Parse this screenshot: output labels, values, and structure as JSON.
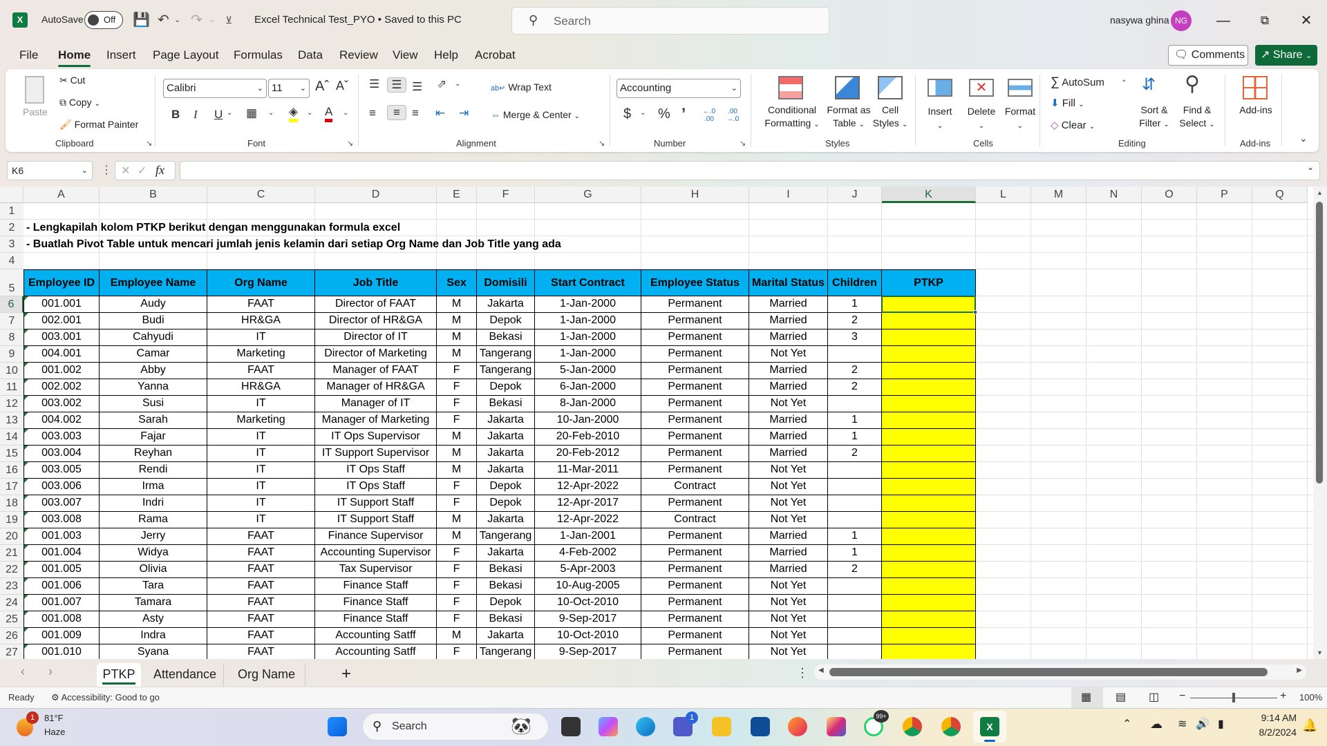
{
  "titlebar": {
    "autosave_label": "AutoSave",
    "autosave_state": "Off",
    "document_title": "Excel Technical Test_PYO • Saved to this PC",
    "search_placeholder": "Search",
    "user_name": "nasywa ghina",
    "user_initials": "NG",
    "avatar_color": "#c43ec0"
  },
  "menu": {
    "items": [
      "File",
      "Home",
      "Insert",
      "Page Layout",
      "Formulas",
      "Data",
      "Review",
      "View",
      "Help",
      "Acrobat"
    ],
    "active": "Home",
    "comments_label": "Comments",
    "share_label": "Share",
    "share_color": "#0f6a3a"
  },
  "ribbon": {
    "clipboard": {
      "label": "Clipboard",
      "paste": "Paste",
      "cut": "Cut",
      "copy": "Copy",
      "format_painter": "Format Painter"
    },
    "font": {
      "label": "Font",
      "font_name": "Calibri",
      "font_size": "11",
      "bold": "B",
      "italic": "I",
      "underline": "U",
      "grow": "Aˆ",
      "shrink": "Aˇ"
    },
    "alignment": {
      "label": "Alignment",
      "wrap_text": "Wrap Text",
      "merge_center": "Merge & Center"
    },
    "number": {
      "label": "Number",
      "format": "Accounting",
      "currency": "$",
      "percent": "%",
      "comma": "’",
      "inc_decimal": "←.0 .00",
      "dec_decimal": ".00 →.0"
    },
    "styles": {
      "label": "Styles",
      "conditional_1": "Conditional",
      "conditional_2": "Formatting",
      "format_table_1": "Format as",
      "format_table_2": "Table",
      "cell_styles_1": "Cell",
      "cell_styles_2": "Styles"
    },
    "cells": {
      "label": "Cells",
      "insert": "Insert",
      "delete": "Delete",
      "format": "Format"
    },
    "editing": {
      "label": "Editing",
      "autosum": "AutoSum",
      "fill": "Fill",
      "clear": "Clear",
      "sort_1": "Sort &",
      "sort_2": "Filter",
      "find_1": "Find &",
      "find_2": "Select"
    },
    "addins": {
      "label": "Add-ins",
      "addins": "Add-ins"
    }
  },
  "formula_bar": {
    "name_box": "K6",
    "formula": ""
  },
  "sheet": {
    "columns": [
      "A",
      "B",
      "C",
      "D",
      "E",
      "F",
      "G",
      "H",
      "I",
      "J",
      "K",
      "L",
      "M",
      "N",
      "O",
      "P",
      "Q"
    ],
    "selected_column": "K",
    "selected_cell": "K6",
    "rows": [
      "1",
      "2",
      "3",
      "4",
      "5",
      "6",
      "7",
      "8",
      "9",
      "10",
      "11",
      "12",
      "13",
      "14",
      "15",
      "16",
      "17",
      "18",
      "19",
      "20",
      "21",
      "22",
      "23",
      "24",
      "25",
      "26",
      "27"
    ],
    "notes": [
      "- Lengkapilah kolom PTKP berikut dengan menggunakan formula excel",
      "- Buatlah Pivot Table untuk mencari jumlah jenis kelamin dari setiap Org Name dan Job Title yang ada"
    ],
    "header_color": "#00b0f0",
    "ptkp_color": "#ffff00",
    "table_headers": [
      "Employee ID",
      "Employee Name",
      "Org Name",
      "Job Title",
      "Sex",
      "Domisili",
      "Start Contract",
      "Employee Status",
      "Marital Status",
      "Children",
      "PTKP"
    ],
    "table_rows": [
      [
        "001.001",
        "Audy",
        "FAAT",
        "Director of FAAT",
        "M",
        "Jakarta",
        "1-Jan-2000",
        "Permanent",
        "Married",
        "1",
        ""
      ],
      [
        "002.001",
        "Budi",
        "HR&GA",
        "Director of HR&GA",
        "M",
        "Depok",
        "1-Jan-2000",
        "Permanent",
        "Married",
        "2",
        ""
      ],
      [
        "003.001",
        "Cahyudi",
        "IT",
        "Director of IT",
        "M",
        "Bekasi",
        "1-Jan-2000",
        "Permanent",
        "Married",
        "3",
        ""
      ],
      [
        "004.001",
        "Camar",
        "Marketing",
        "Director of Marketing",
        "M",
        "Tangerang",
        "1-Jan-2000",
        "Permanent",
        "Not Yet",
        "",
        ""
      ],
      [
        "001.002",
        "Abby",
        "FAAT",
        "Manager of FAAT",
        "F",
        "Tangerang",
        "5-Jan-2000",
        "Permanent",
        "Married",
        "2",
        ""
      ],
      [
        "002.002",
        "Yanna",
        "HR&GA",
        "Manager of HR&GA",
        "F",
        "Depok",
        "6-Jan-2000",
        "Permanent",
        "Married",
        "2",
        ""
      ],
      [
        "003.002",
        "Susi",
        "IT",
        "Manager of IT",
        "F",
        "Bekasi",
        "8-Jan-2000",
        "Permanent",
        "Not Yet",
        "",
        ""
      ],
      [
        "004.002",
        "Sarah",
        "Marketing",
        "Manager of Marketing",
        "F",
        "Jakarta",
        "10-Jan-2000",
        "Permanent",
        "Married",
        "1",
        ""
      ],
      [
        "003.003",
        "Fajar",
        "IT",
        "IT Ops Supervisor",
        "M",
        "Jakarta",
        "20-Feb-2010",
        "Permanent",
        "Married",
        "1",
        ""
      ],
      [
        "003.004",
        "Reyhan",
        "IT",
        "IT Support Supervisor",
        "M",
        "Jakarta",
        "20-Feb-2012",
        "Permanent",
        "Married",
        "2",
        ""
      ],
      [
        "003.005",
        "Rendi",
        "IT",
        "IT Ops Staff",
        "M",
        "Jakarta",
        "11-Mar-2011",
        "Permanent",
        "Not Yet",
        "",
        ""
      ],
      [
        "003.006",
        "Irma",
        "IT",
        "IT Ops Staff",
        "F",
        "Depok",
        "12-Apr-2022",
        "Contract",
        "Not Yet",
        "",
        ""
      ],
      [
        "003.007",
        "Indri",
        "IT",
        "IT Support Staff",
        "F",
        "Depok",
        "12-Apr-2017",
        "Permanent",
        "Not Yet",
        "",
        ""
      ],
      [
        "003.008",
        "Rama",
        "IT",
        "IT Support Staff",
        "M",
        "Jakarta",
        "12-Apr-2022",
        "Contract",
        "Not Yet",
        "",
        ""
      ],
      [
        "001.003",
        "Jerry",
        "FAAT",
        "Finance Supervisor",
        "M",
        "Tangerang",
        "1-Jan-2001",
        "Permanent",
        "Married",
        "1",
        ""
      ],
      [
        "001.004",
        "Widya",
        "FAAT",
        "Accounting Supervisor",
        "F",
        "Jakarta",
        "4-Feb-2002",
        "Permanent",
        "Married",
        "1",
        ""
      ],
      [
        "001.005",
        "Olivia",
        "FAAT",
        "Tax Supervisor",
        "F",
        "Bekasi",
        "5-Apr-2003",
        "Permanent",
        "Married",
        "2",
        ""
      ],
      [
        "001.006",
        "Tara",
        "FAAT",
        "Finance Staff",
        "F",
        "Bekasi",
        "10-Aug-2005",
        "Permanent",
        "Not Yet",
        "",
        ""
      ],
      [
        "001.007",
        "Tamara",
        "FAAT",
        "Finance Staff",
        "F",
        "Depok",
        "10-Oct-2010",
        "Permanent",
        "Not Yet",
        "",
        ""
      ],
      [
        "001.008",
        "Asty",
        "FAAT",
        "Finance Staff",
        "F",
        "Bekasi",
        "9-Sep-2017",
        "Permanent",
        "Not Yet",
        "",
        ""
      ],
      [
        "001.009",
        "Indra",
        "FAAT",
        "Accounting Satff",
        "M",
        "Jakarta",
        "10-Oct-2010",
        "Permanent",
        "Not Yet",
        "",
        ""
      ],
      [
        "001.010",
        "Syana",
        "FAAT",
        "Accounting Satff",
        "F",
        "Tangerang",
        "9-Sep-2017",
        "Permanent",
        "Not Yet",
        "",
        ""
      ]
    ]
  },
  "sheet_tabs": {
    "tabs": [
      "PTKP",
      "Attendance",
      "Org Name"
    ],
    "active": "PTKP",
    "add": "+"
  },
  "status_bar": {
    "ready": "Ready",
    "accessibility": "Accessibility: Good to go",
    "zoom": "100%",
    "zoom_minus": "−",
    "zoom_plus": "+",
    "zoom_level_fraction": 0.5
  },
  "taskbar": {
    "weather_temp": "81°F",
    "weather_desc": "Haze",
    "weather_badge": "1",
    "search_placeholder": "Search",
    "teams_badge": "1",
    "whatsapp_badge": "99+",
    "time": "9:14 AM",
    "date": "8/2/2024"
  }
}
